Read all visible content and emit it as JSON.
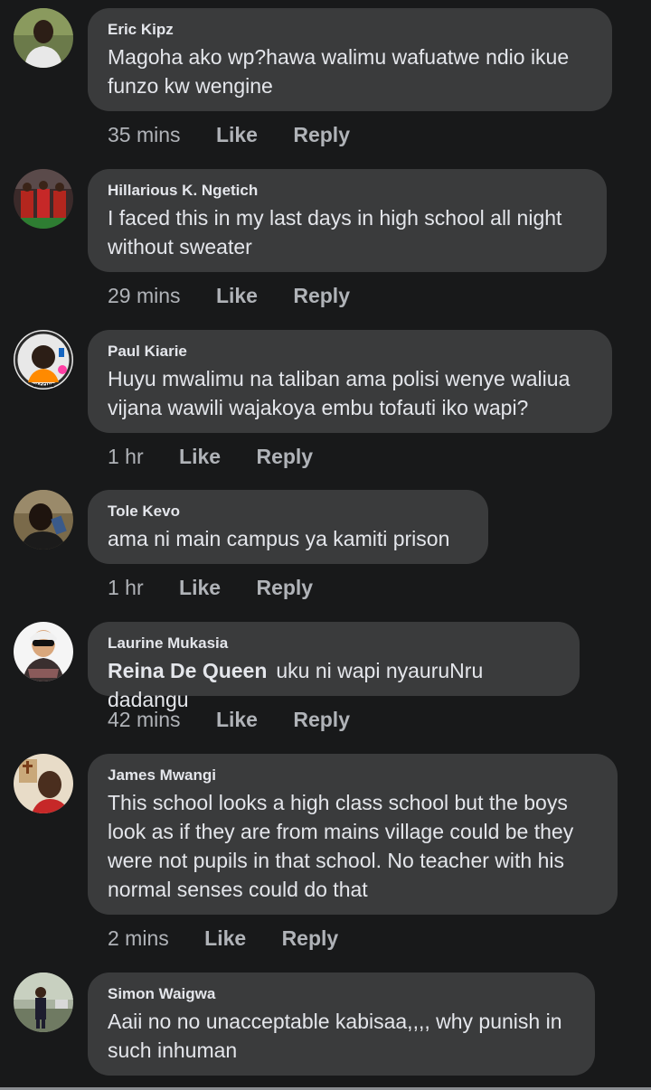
{
  "comments": [
    {
      "author": "Eric Kipz",
      "text": "Magoha ako wp?hawa walimu wafuatwe ndio ikue funzo kw wengine",
      "time": "35 mins",
      "like": "Like",
      "reply": "Reply"
    },
    {
      "author": "Hillarious K. Ngetich",
      "text": "I faced this in my last days in high school all night without sweater",
      "time": "29 mins",
      "like": "Like",
      "reply": "Reply"
    },
    {
      "author": "Paul Kiarie",
      "text": "Huyu mwalimu na taliban ama polisi wenye waliua vijana wawili wajakoya embu tofauti iko wapi?",
      "time": "1 hr",
      "like": "Like",
      "reply": "Reply",
      "avatar_badge": "VACCINE"
    },
    {
      "author": "Tole Kevo",
      "text": "ama ni main campus ya kamiti prison",
      "time": "1 hr",
      "like": "Like",
      "reply": "Reply"
    },
    {
      "author": "Laurine Mukasia",
      "tag": "Reina De Queen",
      "text": "uku ni wapi nyauruNru dadangu",
      "time": "42 mins",
      "like": "Like",
      "reply": "Reply"
    },
    {
      "author": "James Mwangi",
      "text": "This school looks a high class school but the boys look as if they are from mains village could be they were not pupils in that school. No teacher with his normal senses could do that",
      "time": "2 mins",
      "like": "Like",
      "reply": "Reply"
    },
    {
      "author": "Simon Waigwa",
      "text": "Aaii no no unacceptable kabisaa,,,, why punish in such inhuman",
      "time": "",
      "like": "",
      "reply": ""
    }
  ],
  "colors": {
    "background": "#18191a",
    "bubble": "#3a3b3c",
    "primary_text": "#e4e6eb",
    "secondary_text": "#b0b3b8"
  }
}
